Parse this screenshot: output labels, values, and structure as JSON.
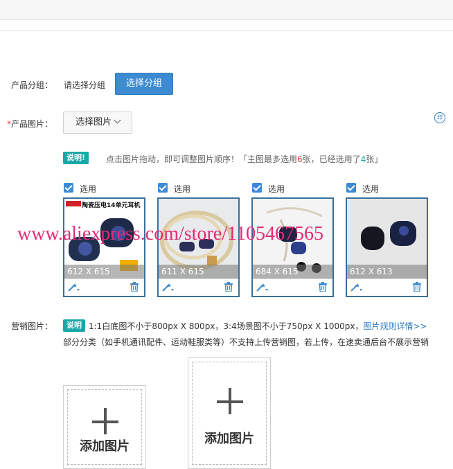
{
  "product_group": {
    "label": "产品分组",
    "value": "请选择分组",
    "button": "选择分组"
  },
  "product_images": {
    "required_mark": "*",
    "label": "产品图片",
    "select_button": "选择图片",
    "note_badge": "说明!",
    "hint_prefix": "点击图片拖动，即可调整图片顺序！「主图最多选用",
    "max_count": "6",
    "hint_middle": "张，已经选用了",
    "used_count": "4",
    "hint_suffix": "张」",
    "items": [
      {
        "select_label": "选用",
        "dimensions": "612 X 615",
        "banner_title": "陶瓷压电14单元耳机"
      },
      {
        "select_label": "选用",
        "dimensions": "611 X 615"
      },
      {
        "select_label": "选用",
        "dimensions": "684 X 615"
      },
      {
        "select_label": "选用",
        "dimensions": "612 X 613"
      }
    ],
    "watermark": "www.aliexpress.com/store/1105467565"
  },
  "marketing_images": {
    "label": "营销图片",
    "note_badge": "说明",
    "line1": "1:1白底图不小于800px X 800px，3:4场景图不小于750px X 1000px，",
    "rules_link": "图片规则详情>>",
    "line2": "部分分类（如手机通讯配件、运动鞋服类等）不支持上传营销图，若上传，在速卖通后台不展示营销",
    "add_label_1": "添加图片",
    "add_label_2": "添加图片"
  },
  "colors": {
    "accent": "#3d8bd1",
    "badge": "#19a8a8",
    "watermark": "#e32a75",
    "required": "#e4393c"
  }
}
